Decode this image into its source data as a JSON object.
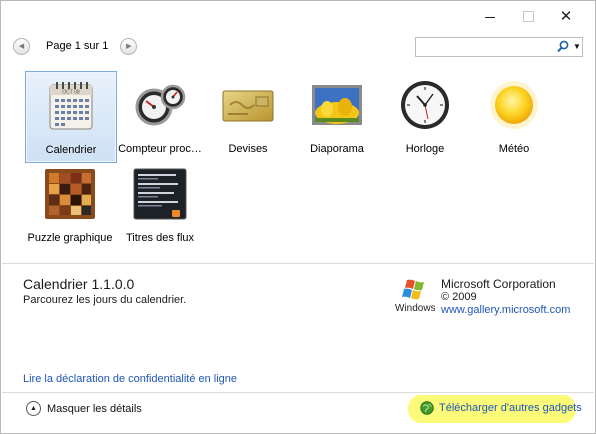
{
  "pager": {
    "prev_icon": "chevron-left-icon",
    "text": "Page 1 sur 1",
    "next_icon": "chevron-right-icon"
  },
  "search": {
    "value": "",
    "placeholder": ""
  },
  "gadgets": [
    {
      "id": "calendrier",
      "label": "Calendrier",
      "icon": "calendar-icon",
      "selected": true,
      "calendar_month": "OCT 08"
    },
    {
      "id": "compteur",
      "label": "Compteur proc…",
      "icon": "cpu-meter-icon"
    },
    {
      "id": "devises",
      "label": "Devises",
      "icon": "currency-card-icon"
    },
    {
      "id": "diaporama",
      "label": "Diaporama",
      "icon": "slideshow-icon"
    },
    {
      "id": "horloge",
      "label": "Horloge",
      "icon": "clock-icon"
    },
    {
      "id": "meteo",
      "label": "Météo",
      "icon": "weather-sun-icon"
    },
    {
      "id": "puzzle",
      "label": "Puzzle graphique",
      "icon": "puzzle-icon"
    },
    {
      "id": "flux",
      "label": "Titres des flux",
      "icon": "feed-headlines-icon"
    }
  ],
  "details": {
    "title": "Calendrier 1.1.0.0",
    "description": "Parcourez les jours du calendrier.",
    "publisher_logo_text": "Windows",
    "publisher": "Microsoft Corporation",
    "copyright": "© 2009",
    "website": "www.gallery.microsoft.com",
    "privacy_link": "Lire la déclaration de confidentialité en ligne"
  },
  "footer": {
    "hide_details": "Masquer les détails",
    "download_more": "Télécharger d'autres gadgets",
    "highlight_color": "#fbfb79"
  },
  "colors": {
    "link": "#1f56b8",
    "selection": "#cfe1f6"
  }
}
